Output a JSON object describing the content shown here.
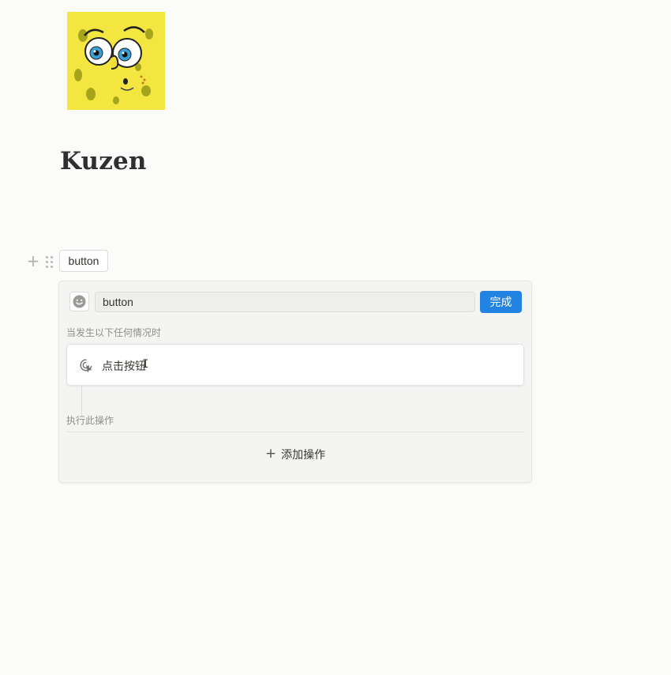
{
  "page": {
    "title": "Kuzen",
    "icon": "spongebob-face-icon"
  },
  "block": {
    "add_icon": "plus-icon",
    "drag_icon": "drag-handle-icon",
    "button_label": "button"
  },
  "editor": {
    "emoji_icon": "smiley-icon",
    "name_value": "button",
    "done_label": "完成",
    "trigger_section_label": "当发生以下任何情况时",
    "trigger_label": "点击按钮",
    "trigger_icon": "click-pointer-icon",
    "action_section_label": "执行此操作",
    "add_action_label": "添加操作",
    "add_action_icon": "plus-icon"
  },
  "colors": {
    "accent": "#2383e2",
    "background": "#fbfbfa",
    "panel": "#f4f4f3"
  }
}
